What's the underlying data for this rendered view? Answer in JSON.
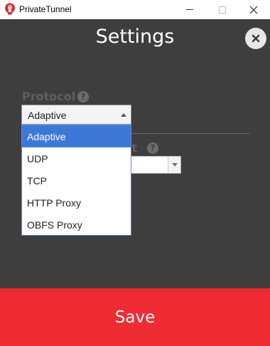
{
  "window": {
    "title": "PrivateTunnel",
    "brand_color": "#e32b35",
    "controls": {
      "minimize": "minimize",
      "maximize": "maximize",
      "close": "close"
    }
  },
  "settings": {
    "title": "Settings",
    "close_icon": "close-icon"
  },
  "protocol": {
    "label": "Protocol",
    "help": "?",
    "selected": "Adaptive",
    "options": [
      "Adaptive",
      "UDP",
      "TCP",
      "HTTP Proxy",
      "OBFS Proxy"
    ]
  },
  "second_field": {
    "label_visible": "ut",
    "help": "?"
  },
  "save": {
    "label": "Save",
    "color": "#ef2b33"
  }
}
